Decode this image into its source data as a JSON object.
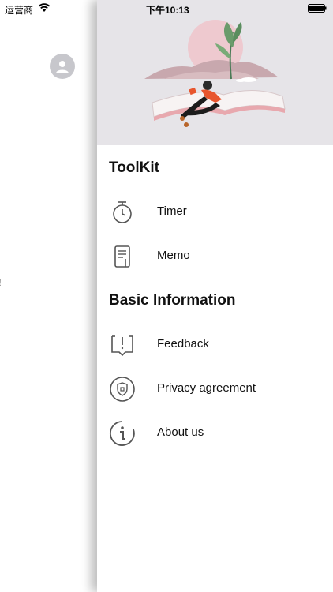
{
  "status_bar": {
    "carrier": "运营商",
    "time": "下午10:13"
  },
  "background_page": {
    "partial_text": "!"
  },
  "drawer": {
    "sections": [
      {
        "title": "ToolKit",
        "items": [
          {
            "label": "Timer",
            "icon": "timer-icon"
          },
          {
            "label": "Memo",
            "icon": "memo-icon"
          }
        ]
      },
      {
        "title": "Basic Information",
        "items": [
          {
            "label": "Feedback",
            "icon": "feedback-icon"
          },
          {
            "label": "Privacy agreement",
            "icon": "privacy-shield-icon"
          },
          {
            "label": "About us",
            "icon": "info-icon"
          }
        ]
      }
    ]
  },
  "colors": {
    "hero_background": "#e6e4e8",
    "accent_orange": "#e8562e",
    "icon_gray": "#555555"
  }
}
